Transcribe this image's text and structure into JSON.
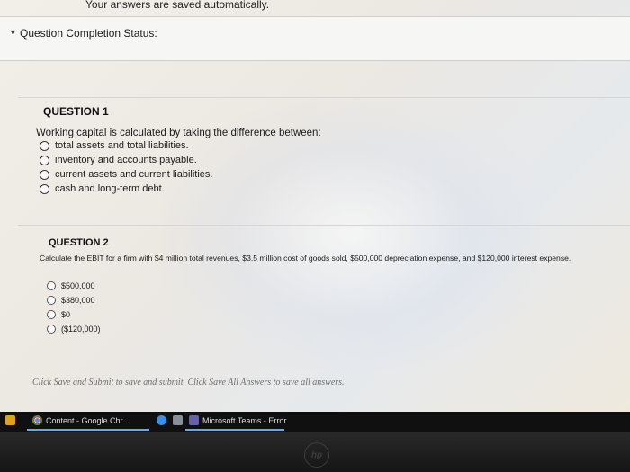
{
  "header": {
    "saved_note": "Your answers are saved automatically.",
    "status_label": "Question Completion Status:"
  },
  "question1": {
    "title": "QUESTION 1",
    "text": "Working capital is calculated by taking the difference between:",
    "options": [
      "total assets and total liabilities.",
      "inventory and accounts payable.",
      "current assets and current liabilities.",
      "cash and long-term debt."
    ]
  },
  "question2": {
    "title": "QUESTION 2",
    "text": "Calculate the EBIT for a firm with $4 million total revenues, $3.5 million cost of goods sold, $500,000 depreciation expense, and $120,000 interest expense.",
    "options": [
      "$500,000",
      "$380,000",
      "$0",
      "($120,000)"
    ]
  },
  "footer": {
    "note": "Click Save and Submit to save and submit. Click Save All Answers to save all answers."
  },
  "taskbar": {
    "chrome_label": "Content - Google Chr...",
    "teams_label": "Microsoft Teams - Error"
  },
  "colors": {
    "page_background": "#efece6",
    "taskbar": "#101010",
    "active_underline": "#6aa6e8"
  }
}
